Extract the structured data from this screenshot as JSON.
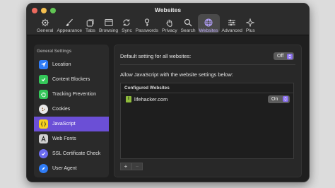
{
  "window": {
    "title": "Websites"
  },
  "toolbar": [
    {
      "label": "General",
      "icon": "gear-icon"
    },
    {
      "label": "Appearance",
      "icon": "brush-icon"
    },
    {
      "label": "Tabs",
      "icon": "tabs-icon"
    },
    {
      "label": "Browsing",
      "icon": "browser-window-icon"
    },
    {
      "label": "Sync",
      "icon": "sync-icon"
    },
    {
      "label": "Passwords",
      "icon": "key-icon"
    },
    {
      "label": "Privacy",
      "icon": "hand-icon"
    },
    {
      "label": "Search",
      "icon": "search-icon"
    },
    {
      "label": "Websites",
      "icon": "globe-icon",
      "active": true
    },
    {
      "label": "Advanced",
      "icon": "sliders-icon"
    },
    {
      "label": "Plus",
      "icon": "sparkle-icon"
    }
  ],
  "sidebar": {
    "header": "General Settings",
    "items": [
      {
        "label": "Location",
        "icon": "location-arrow-icon",
        "color": "#2f7cf6"
      },
      {
        "label": "Content Blockers",
        "icon": "shield-check-icon",
        "color": "#34c759"
      },
      {
        "label": "Tracking Prevention",
        "icon": "hand-stop-icon",
        "color": "#34c759"
      },
      {
        "label": "Cookies",
        "icon": "cookie-icon",
        "color": "#e8e8e8"
      },
      {
        "label": "JavaScript",
        "icon": "javascript-braces-icon",
        "color": "#f7d11e",
        "selected": true
      },
      {
        "label": "Web Fonts",
        "icon": "font-letter-icon",
        "color": "#d0d0d0"
      },
      {
        "label": "SSL Certificate Check",
        "icon": "certificate-check-icon",
        "color": "#6b6bf0"
      },
      {
        "label": "User Agent",
        "icon": "compass-icon",
        "color": "#2f7cf6"
      }
    ]
  },
  "content": {
    "default_label": "Default setting for all websites:",
    "default_value": "Off",
    "allow_label": "Allow JavaScript with the website settings below:",
    "table_header": "Configured Websites",
    "sites": [
      {
        "name": "lifehacker.com",
        "favicon": "l",
        "value": "On"
      }
    ],
    "add_label": "+",
    "remove_label": "−"
  },
  "colors": {
    "accent": "#6b4fd6",
    "popup_arrow": "#8a6ff0"
  }
}
